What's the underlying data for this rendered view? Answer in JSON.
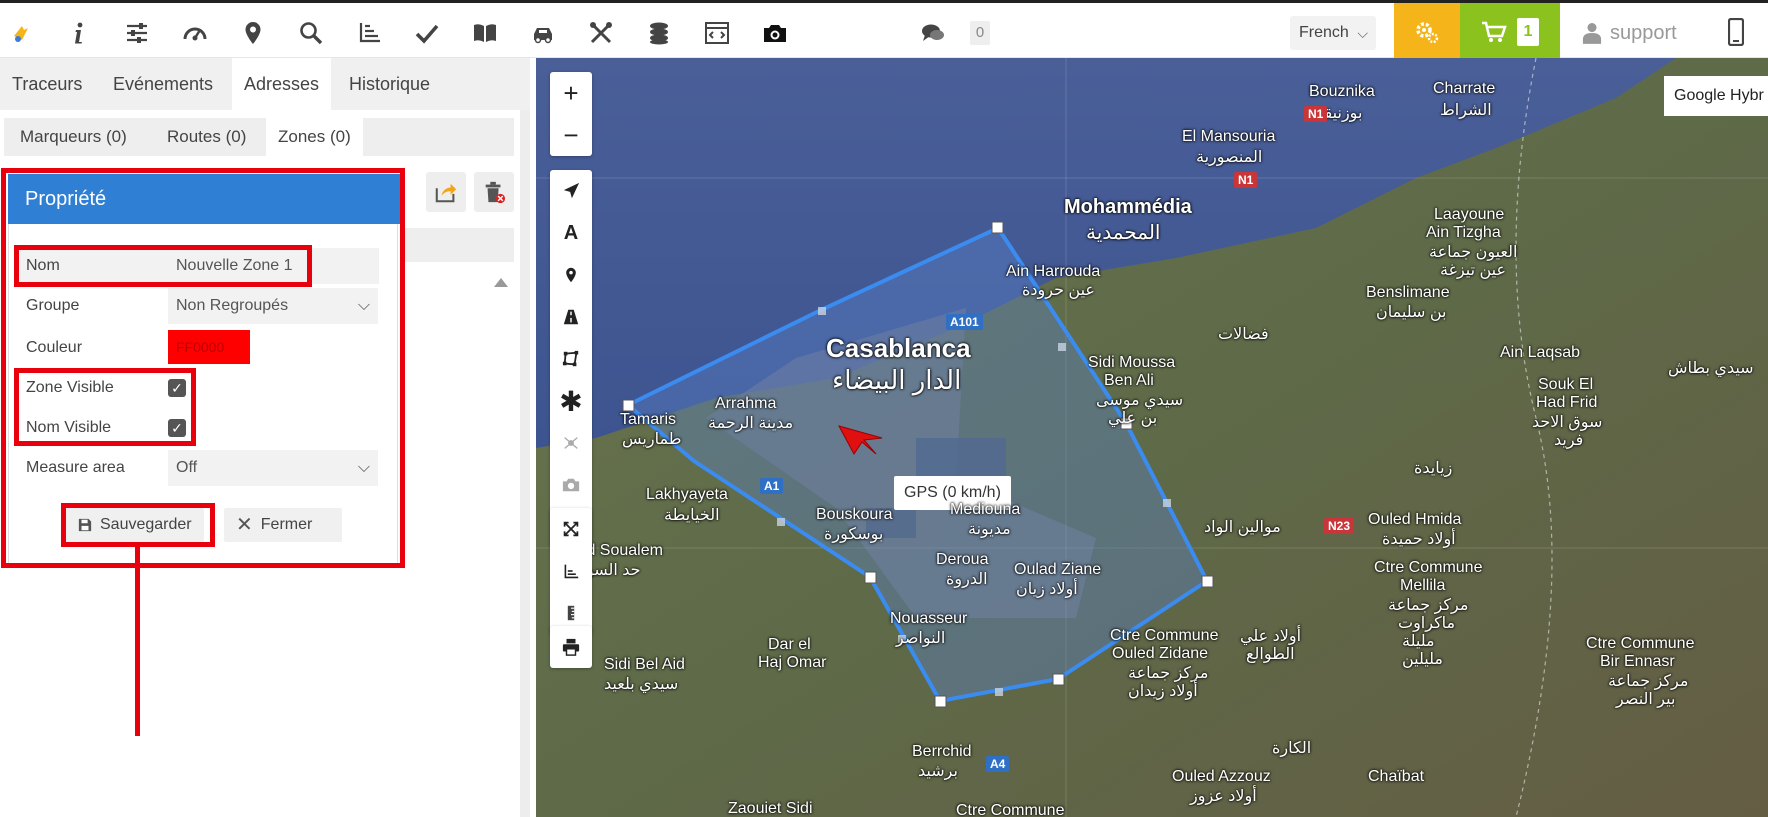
{
  "topbar": {
    "icons": [
      "logo-icon",
      "info-icon",
      "sliders-icon",
      "speedometer-icon",
      "map-pin-icon",
      "search-icon",
      "chart-axis-icon",
      "check-icon",
      "book-icon",
      "car-gps-icon",
      "tools-icon",
      "coins-icon",
      "code-window-icon",
      "camera-icon",
      "chat-icon"
    ],
    "message_count": "0",
    "language": "French",
    "cart_count": "1",
    "user": "support"
  },
  "main_tabs": [
    "Traceurs",
    "Evénements",
    "Adresses",
    "Historique"
  ],
  "sub_tabs": [
    "Marqueurs (0)",
    "Routes (0)",
    "Zones (0)"
  ],
  "dialog": {
    "title": "Propriété",
    "nom_label": "Nom",
    "nom_value": "Nouvelle Zone 1",
    "groupe_label": "Groupe",
    "groupe_value": "Non Regroupés",
    "couleur_label": "Couleur",
    "couleur_value": "FF0000",
    "zone_visible_label": "Zone Visible",
    "nom_visible_label": "Nom Visible",
    "measure_label": "Measure area",
    "measure_value": "Off",
    "save_label": "Sauvegarder",
    "close_label": "Fermer"
  },
  "map": {
    "layer_label": "Google Hybr",
    "gps_tooltip": "GPS (0 km/h)",
    "labels": {
      "casablanca": "Casablanca",
      "casablanca_ar": "الدار البيضاء",
      "mohammedia": "Mohammédia",
      "mohammedia_ar": "المحمدية",
      "bouznika": "Bouznika",
      "bouznika_ar": "بوزنيقة",
      "charrate": "Charrate",
      "charrate_ar": "الشراط",
      "el_mansouria": "El Mansouria",
      "el_mansouria_ar": "المنصورية",
      "ain_harrouda": "Ain Harrouda",
      "ain_harrouda_ar": "عين حرودة",
      "laayoune": "Laayoune",
      "ain_tizgha": "Ain Tizgha",
      "ain_tizgha_ar": "العيون جماعة",
      "ain_tizgha_ar2": "عين تيزغة",
      "benslimane": "Benslimane",
      "benslimane_ar": "بن سليمان",
      "fadalat_ar": "فضالات",
      "sidi_moussa": "Sidi Moussa",
      "ben_ali": "Ben Ali",
      "sidi_moussa_ar": "سيدي موسى",
      "ben_ali_ar": "بن علي",
      "ain_laqsab": "Ain Laqsab",
      "souk_el_had": "Souk El",
      "had_frid": "Had Frid",
      "souk_ar": "سوق الاحد",
      "frid_ar": "فريد",
      "sidi_btach_ar": "سيدي بطاش",
      "tamaris": "Tamaris",
      "tamaris_ar": "طماريس",
      "arrahma": "Arrahma",
      "arrahma_ar": "مدينة الرحمة",
      "lakhyayta": "Lakhyayeta",
      "lakhyayta_ar": "الخيايطة",
      "had_soualem": "Had Soualem",
      "had_soualem_ar": "حد السوالم",
      "bouskoura": "Bouskoura",
      "bouskoura_ar": "بوسكورة",
      "mediouna": "Mediouna",
      "mediouna_ar": "مديونة",
      "deroua": "Deroua",
      "deroua_ar": "الدروة",
      "oulad_ziane": "Oulad Ziane",
      "oulad_ziane_ar": "أولاد زيان",
      "nouasseur": "Nouasseur",
      "nouasseur_ar": "النواصر",
      "dar_el_haj": "Dar el",
      "haj_omar": "Haj Omar",
      "sidi_bel_aid": "Sidi Bel Aid",
      "sidi_bel_aid_ar": "سيدي بلعيد",
      "berrchid": "Berrchid",
      "berrchid_ar": "برشيد",
      "zaouiet": "Zaouiet Sidi",
      "ctre_commune_bottom": "Ctre Commune",
      "ouled_azzouz": "Ouled Azzouz",
      "ouled_azzouz_ar": "أولاد عزوز",
      "chaibat": "Chaïbat",
      "ctre_commune_oz": "Ctre Commune",
      "ouled_zidane": "Ouled Zidane",
      "ouled_zidane_ar": "مركز جماعة",
      "ouled_zidane_ar2": "أولاد زيدان",
      "oulad_ali_ar": "أولاد علي",
      "tawalia_ar": "الطوالع",
      "mellila_ctre": "Ctre Commune",
      "mellila": "Mellila",
      "mellila_ar": "مركز جماعة",
      "mellila_ar2": "ماكراوت",
      "mellila_ar3": "مليلة",
      "mellila_ar4": "مليلين",
      "ouled_hmida": "Ouled Hmida",
      "ouled_hmida_ar": "أولاد حميدة",
      "zyayda_ar": "زيايدة",
      "mwalin_ar": "موالين الواد",
      "bir_ennasr_ctre": "Ctre Commune",
      "bir_ennasr": "Bir Ennasr",
      "bir_ennasr_ar": "مركز جماعة",
      "bir_ennasr_ar2": "بير النصر",
      "lgara_ar": "الكارة"
    },
    "roads": [
      "N1",
      "N1",
      "A101",
      "A1",
      "N23",
      "A4"
    ]
  }
}
